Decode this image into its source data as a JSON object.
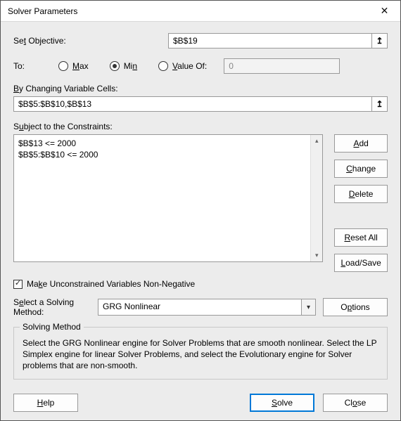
{
  "window": {
    "title": "Solver Parameters"
  },
  "objective": {
    "label_pre": "Se",
    "label_u": "t",
    "label_post": " Objective:",
    "value": "$B$19"
  },
  "to": {
    "label": "To:",
    "max_u": "M",
    "max": "ax",
    "min": "Mi",
    "min_u": "n",
    "valueof_u": "V",
    "valueof": "alue Of:",
    "value_disabled": "0",
    "selected": "min"
  },
  "changing": {
    "label_u": "B",
    "label": "y Changing Variable Cells:",
    "value": "$B$5:$B$10,$B$13"
  },
  "constraints": {
    "label": "S",
    "label_u": "u",
    "label_post": "bject to the Constraints:",
    "items": [
      "$B$13 <= 2000",
      "$B$5:$B$10 <= 2000"
    ]
  },
  "buttons": {
    "add_u": "A",
    "add": "dd",
    "change_u": "C",
    "change": "hange",
    "delete_u": "D",
    "delete": "elete",
    "reset_u": "R",
    "reset": "eset All",
    "loadsave_u": "L",
    "loadsave": "oad/Save",
    "options": "O",
    "options_u": "p",
    "options_post": "tions",
    "help_u": "H",
    "help": "elp",
    "solve_u": "S",
    "solve": "olve",
    "close": "Cl",
    "close_u": "o",
    "close_post": "se"
  },
  "nonneg": {
    "pre": "Ma",
    "u": "k",
    "post": "e Unconstrained Variables Non-Negative",
    "checked": true
  },
  "method": {
    "label_pre": "S",
    "label_u": "e",
    "label_post": "lect a Solving Method:",
    "selected": "GRG Nonlinear"
  },
  "info": {
    "legend": "Solving Method",
    "text": "Select the GRG Nonlinear engine for Solver Problems that are smooth nonlinear. Select the LP Simplex engine for linear Solver Problems, and select the Evolutionary engine for Solver problems that are non-smooth."
  }
}
